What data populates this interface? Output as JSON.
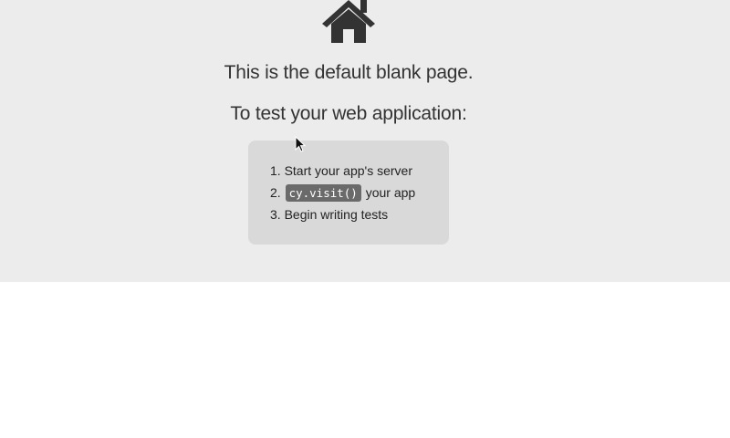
{
  "page": {
    "heading": "This is the default blank page.",
    "subheading": "To test your web application:"
  },
  "steps": [
    {
      "number": "1.",
      "text": "Start your app's server"
    },
    {
      "number": "2.",
      "code": "cy.visit()",
      "text": "your app"
    },
    {
      "number": "3.",
      "text": "Begin writing tests"
    }
  ],
  "icons": {
    "header_icon": "home-icon",
    "pointer": "mouse-cursor-icon"
  },
  "colors": {
    "panel_background": "#ececec",
    "box_background": "#d9d9d9",
    "code_chip": "#6a6a6a",
    "icon": "#333333"
  }
}
